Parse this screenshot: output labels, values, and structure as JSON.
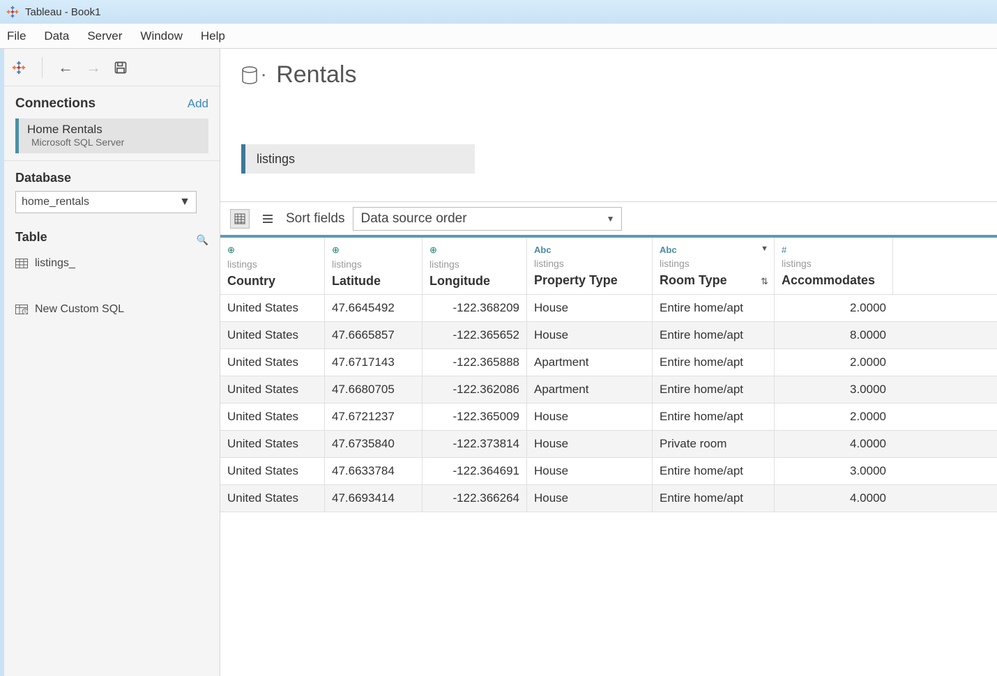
{
  "window": {
    "title": "Tableau - Book1"
  },
  "menu": [
    "File",
    "Data",
    "Server",
    "Window",
    "Help"
  ],
  "sidebar": {
    "connections_label": "Connections",
    "add_label": "Add",
    "connection": {
      "name": "Home Rentals",
      "type": "Microsoft SQL Server"
    },
    "database_label": "Database",
    "database_selected": "home_rentals",
    "table_label": "Table",
    "table_item": "listings_",
    "custom_sql": "New Custom SQL"
  },
  "datasource": {
    "title": "Rentals",
    "table_pill": "listings"
  },
  "grid_toolbar": {
    "sort_fields_label": "Sort fields",
    "sort_selected": "Data source order"
  },
  "columns": [
    {
      "type_icon": "globe",
      "source": "listings",
      "name": "Country",
      "align": "left"
    },
    {
      "type_icon": "globe",
      "source": "listings",
      "name": "Latitude",
      "align": "left"
    },
    {
      "type_icon": "globe",
      "source": "listings",
      "name": "Longitude",
      "align": "right"
    },
    {
      "type_icon": "abc",
      "source": "listings",
      "name": "Property Type",
      "align": "left"
    },
    {
      "type_icon": "abc",
      "source": "listings",
      "name": "Room Type",
      "align": "left",
      "dropdown": true,
      "sort": true
    },
    {
      "type_icon": "hash",
      "source": "listings",
      "name": "Accommodates",
      "align": "right"
    }
  ],
  "rows": [
    [
      "United States",
      "47.6645492",
      "-122.368209",
      "House",
      "Entire home/apt",
      "2.0000"
    ],
    [
      "United States",
      "47.6665857",
      "-122.365652",
      "House",
      "Entire home/apt",
      "8.0000"
    ],
    [
      "United States",
      "47.6717143",
      "-122.365888",
      "Apartment",
      "Entire home/apt",
      "2.0000"
    ],
    [
      "United States",
      "47.6680705",
      "-122.362086",
      "Apartment",
      "Entire home/apt",
      "3.0000"
    ],
    [
      "United States",
      "47.6721237",
      "-122.365009",
      "House",
      "Entire home/apt",
      "2.0000"
    ],
    [
      "United States",
      "47.6735840",
      "-122.373814",
      "House",
      "Private room",
      "4.0000"
    ],
    [
      "United States",
      "47.6633784",
      "-122.364691",
      "House",
      "Entire home/apt",
      "3.0000"
    ],
    [
      "United States",
      "47.6693414",
      "-122.366264",
      "House",
      "Entire home/apt",
      "4.0000"
    ]
  ]
}
